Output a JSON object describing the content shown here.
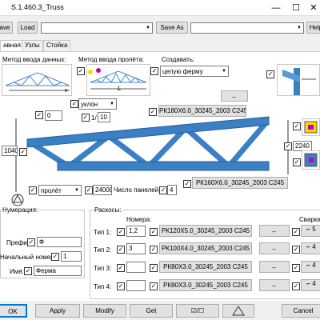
{
  "window": {
    "title": "S.1.460.3_Truss",
    "minimize_icon": "minimize-icon",
    "maximize_icon": "maximize-icon",
    "close_icon": "close-icon"
  },
  "toolbar": {
    "save_label": "ave",
    "load_label": "Load",
    "save_as_label": "Save As",
    "help_label": "Help",
    "file_combo_value": "",
    "saveas_combo_value": ""
  },
  "tabs": [
    {
      "label": "авная"
    },
    {
      "label": "Узлы"
    },
    {
      "label": "Стойка"
    }
  ],
  "input_method": {
    "data_label": "Метод ввода данных:",
    "span_label": "Метод ввода пролёта:",
    "span_symbol": "L",
    "create_label": "Создавать:",
    "create_value": "целую ферму",
    "arrow_label": "←"
  },
  "geometry": {
    "top_offset": "0",
    "slope_combo": "уклон",
    "slope_value": "1/",
    "slope_denominator": "10",
    "top_chord": "РК180Х6.0_30245_2003 С245",
    "height_left": "1040",
    "height_right": "2240",
    "bottom_chord": "РК160Х6.0_30245_2003 С245",
    "span_combo": "пролёт",
    "span_value": "24000",
    "panels_label": "Число панелей:",
    "panels_value": "4"
  },
  "numbering": {
    "title": "Нумерация:",
    "prefix_label": "Префикс:",
    "prefix_value": "Ф",
    "start_label": "Начальный номер:",
    "start_value": "1",
    "name_label": "Имя:",
    "name_value": "Ферма"
  },
  "braces": {
    "title": "Раскосы:",
    "numbers_header": "Номера:",
    "welding_header": "Сварка",
    "rows": [
      {
        "label": "Тип 1:",
        "numbers": "1,2",
        "profile": "РК120Х5.0_30245_2003 С245",
        "arrow": "←",
        "weld": "5"
      },
      {
        "label": "Тип 2:",
        "numbers": "3",
        "profile": "РК100Х4.0_30245_2003 С245",
        "arrow": "←",
        "weld": "4"
      },
      {
        "label": "Тип 3:",
        "numbers": "",
        "profile": "РК80Х3.0_30245_2003 С245",
        "arrow": "←",
        "weld": "4"
      },
      {
        "label": "Тип 4:",
        "numbers": "",
        "profile": "РК80Х3.0_30245_2003 С245",
        "arrow": "←",
        "weld": "4"
      }
    ]
  },
  "footer": {
    "ok_label": "OK",
    "apply_label": "Apply",
    "modify_label": "Modify",
    "get_label": "Get",
    "toggle_label": "☑/☐",
    "warning_icon": "warning-triangle-icon",
    "cancel_label": "Cancel"
  },
  "colors": {
    "steel_blue": "#3b7fc4",
    "accent_yellow": "#ffd700",
    "accent_magenta": "#c000c0"
  }
}
